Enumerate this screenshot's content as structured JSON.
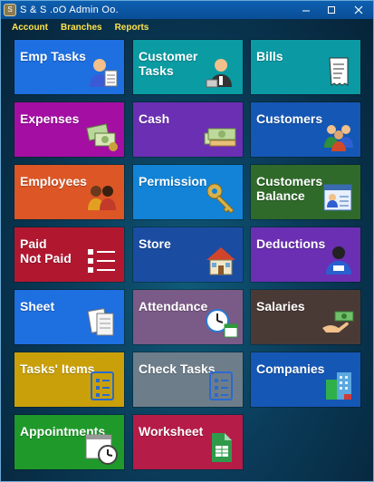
{
  "window": {
    "title": "S & S .oO Admin Oo.",
    "app_icon": "app-logo-icon",
    "controls": [
      "minimize-icon",
      "maximize-icon",
      "close-icon"
    ]
  },
  "menu": {
    "items": [
      {
        "label": "Account"
      },
      {
        "label": "Branches"
      },
      {
        "label": "Reports"
      }
    ],
    "color": "#ffe34d"
  },
  "tiles": [
    {
      "label": "Emp Tasks",
      "color": "#1e6fe0",
      "icon": "employee-task-icon"
    },
    {
      "label": "Customer\nTasks",
      "color": "#0a9ba3",
      "icon": "customer-task-icon"
    },
    {
      "label": "Bills",
      "color": "#0b9aa3",
      "icon": "bill-receipt-icon"
    },
    {
      "label": "Expenses",
      "color": "#a40ea3",
      "icon": "expenses-icon"
    },
    {
      "label": "Cash",
      "color": "#6a2fb3",
      "icon": "cash-stack-icon"
    },
    {
      "label": "Customers",
      "color": "#1557b5",
      "icon": "customers-group-icon"
    },
    {
      "label": "Employees",
      "color": "#dc5626",
      "icon": "employees-group-icon"
    },
    {
      "label": "Permission",
      "color": "#1283d6",
      "icon": "key-icon"
    },
    {
      "label": "Customers\nBalance",
      "color": "#2f6a2a",
      "icon": "customer-balance-icon"
    },
    {
      "label": "Paid\nNot Paid",
      "color": "#b11830",
      "icon": "paid-checklist-icon"
    },
    {
      "label": "Store",
      "color": "#1a4ca2",
      "icon": "store-house-icon"
    },
    {
      "label": "Deductions",
      "color": "#6a2fb3",
      "icon": "deductions-person-icon"
    },
    {
      "label": "Sheet",
      "color": "#1e6fe0",
      "icon": "sheet-documents-icon"
    },
    {
      "label": "Attendance",
      "color": "#7a5a86",
      "icon": "attendance-clock-icon"
    },
    {
      "label": "Salaries",
      "color": "#4a3a36",
      "icon": "salary-payment-icon"
    },
    {
      "label": "Tasks' Items",
      "color": "#c9a00a",
      "icon": "task-items-icon"
    },
    {
      "label": "Check Tasks",
      "color": "#6d7d8a",
      "icon": "check-tasks-icon"
    },
    {
      "label": "Companies",
      "color": "#1557b5",
      "icon": "company-building-icon"
    },
    {
      "label": "Appointments",
      "color": "#1f9a2a",
      "icon": "appointment-calendar-icon"
    },
    {
      "label": "Worksheet",
      "color": "#b51c48",
      "icon": "worksheet-file-icon"
    }
  ]
}
